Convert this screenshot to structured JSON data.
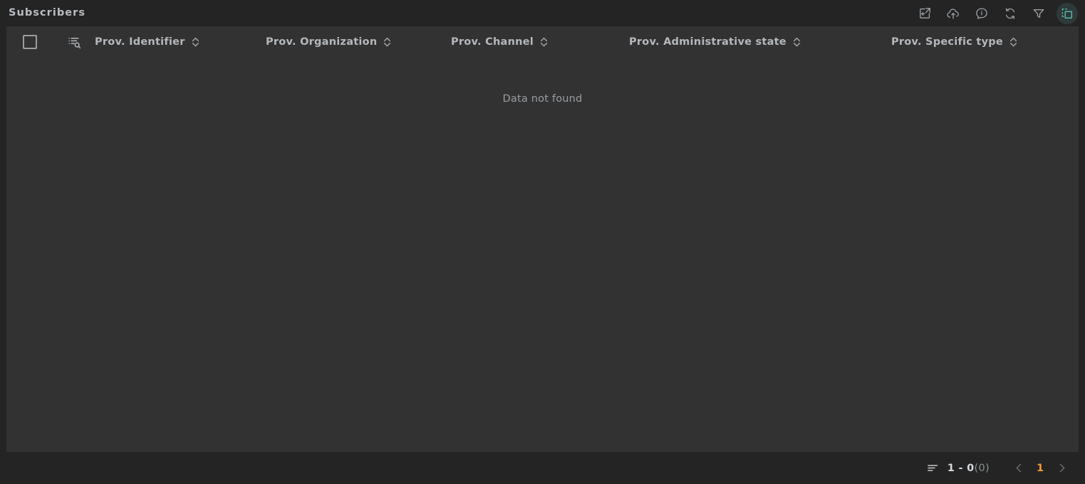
{
  "window": {
    "title": "Subscribers"
  },
  "toolbar": {
    "buttons": [
      {
        "name": "export-window-icon",
        "label": "Export"
      },
      {
        "name": "cloud-upload-icon",
        "label": "Upload"
      },
      {
        "name": "info-bubble-icon",
        "label": "Info"
      },
      {
        "name": "refresh-icon",
        "label": "Refresh"
      },
      {
        "name": "filter-funnel-icon",
        "label": "Filter"
      },
      {
        "name": "column-select-icon",
        "label": "Select columns"
      }
    ],
    "active_index": 5,
    "active_color": "#5ec0b4"
  },
  "table": {
    "select_all_checked": false,
    "search_icon_name": "list-search-icon",
    "columns": [
      {
        "label": "Prov. Identifier",
        "sortable": true
      },
      {
        "label": "Prov. Organization",
        "sortable": true
      },
      {
        "label": "Prov. Channel",
        "sortable": true
      },
      {
        "label": "Prov. Administrative state",
        "sortable": true
      },
      {
        "label": "Prov. Specific type",
        "sortable": true
      }
    ],
    "rows": [],
    "empty_message": "Data not found"
  },
  "pagination": {
    "rows_icon_name": "rows-per-page-icon",
    "range": "1 - 0",
    "total": "(0)",
    "prev_label": "Previous page",
    "next_label": "Next page",
    "current_page": "1",
    "page_color": "#f0a030"
  }
}
